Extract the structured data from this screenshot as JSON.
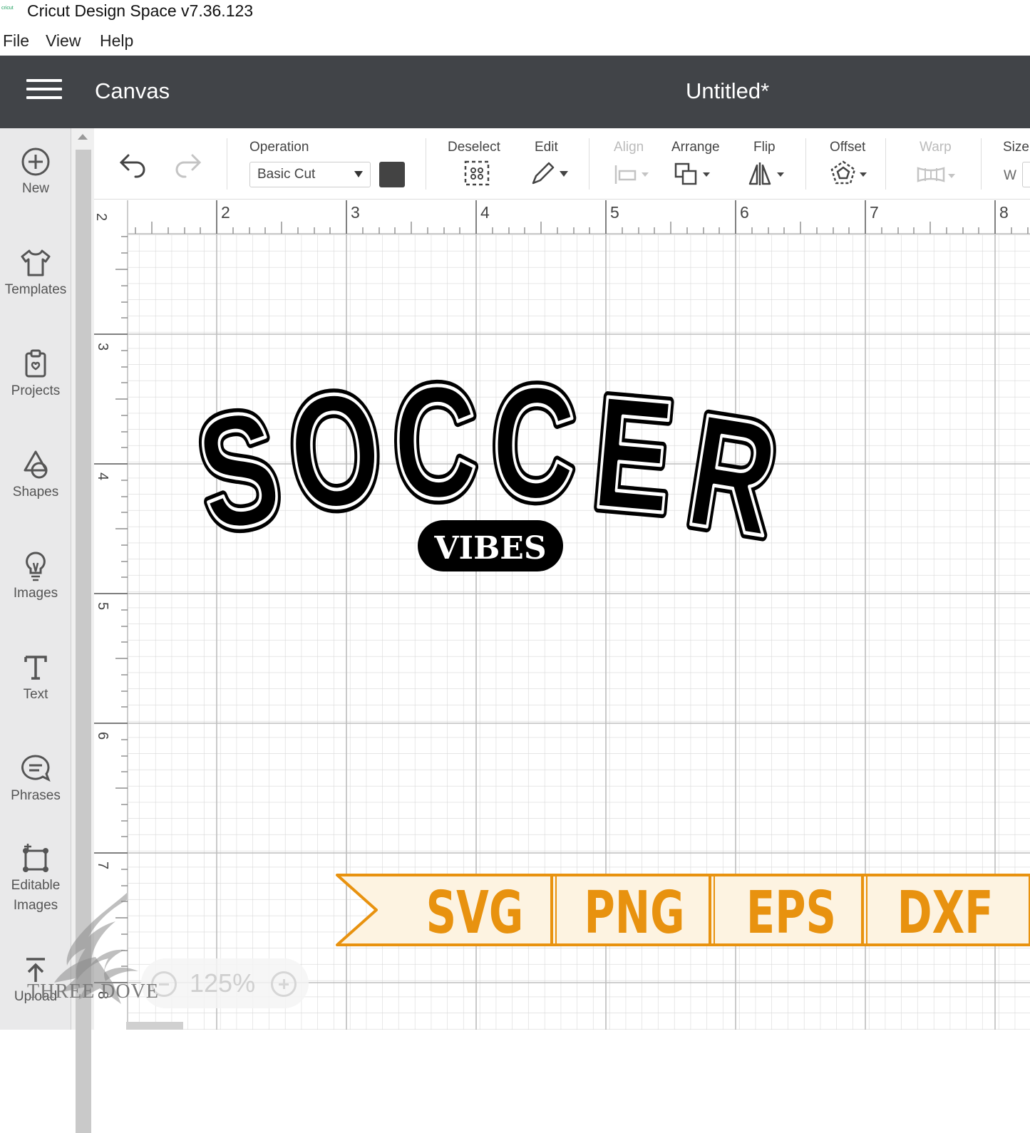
{
  "titlebar": {
    "app_icon_text": "cricut",
    "title": "Cricut Design Space  v7.36.123"
  },
  "menu": {
    "file": "File",
    "view": "View",
    "help": "Help"
  },
  "header": {
    "section": "Canvas",
    "document": "Untitled*"
  },
  "sidebar": {
    "items": [
      {
        "label": "New",
        "icon": "plus-circle-icon"
      },
      {
        "label": "Templates",
        "icon": "tshirt-icon"
      },
      {
        "label": "Projects",
        "icon": "clipboard-icon"
      },
      {
        "label": "Shapes",
        "icon": "shapes-icon"
      },
      {
        "label": "Images",
        "icon": "lightbulb-icon"
      },
      {
        "label": "Text",
        "icon": "text-icon"
      },
      {
        "label": "Phrases",
        "icon": "speech-bubble-icon"
      },
      {
        "label": "Editable",
        "label2": "Images",
        "icon": "edit-image-icon"
      },
      {
        "label": "Upload",
        "icon": "upload-icon"
      }
    ]
  },
  "toolbar": {
    "operation_label": "Operation",
    "operation_value": "Basic Cut",
    "deselect": "Deselect",
    "edit": "Edit",
    "align": "Align",
    "arrange": "Arrange",
    "flip": "Flip",
    "offset": "Offset",
    "warp": "Warp",
    "size": "Size",
    "size_w": "W",
    "swatch_color": "#434343"
  },
  "rulers": {
    "top": [
      "2",
      "3",
      "4",
      "5",
      "6",
      "7",
      "8"
    ],
    "left": [
      "2",
      "3",
      "4",
      "5",
      "6",
      "7",
      "8"
    ],
    "corner": "2"
  },
  "design": {
    "headline": "SOCCER",
    "subline": "VIBES"
  },
  "zoom": {
    "value": "125%"
  },
  "formats": {
    "items": [
      "SVG",
      "PNG",
      "EPS",
      "DXF"
    ],
    "text_color": "#e8920f",
    "bg_color": "#fdf3e1"
  },
  "watermark": {
    "text": "THREE DOVE"
  }
}
